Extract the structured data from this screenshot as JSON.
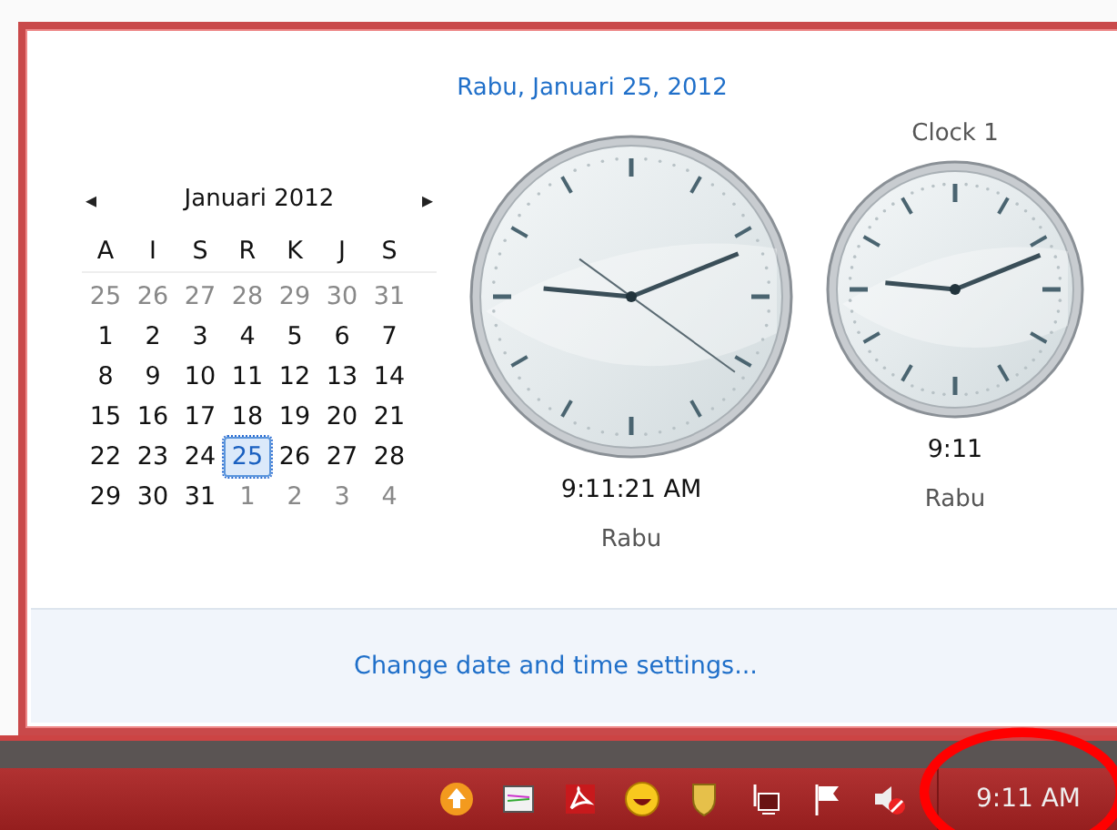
{
  "flyout": {
    "date_heading": "Rabu, Januari 25, 2012",
    "calendar": {
      "prev": "◂",
      "month": "Januari 2012",
      "next": "▸",
      "weekdays": [
        "A",
        "I",
        "S",
        "R",
        "K",
        "J",
        "S"
      ],
      "days": [
        {
          "label": "25",
          "other_month": true,
          "selected": false
        },
        {
          "label": "26",
          "other_month": true,
          "selected": false
        },
        {
          "label": "27",
          "other_month": true,
          "selected": false
        },
        {
          "label": "28",
          "other_month": true,
          "selected": false
        },
        {
          "label": "29",
          "other_month": true,
          "selected": false
        },
        {
          "label": "30",
          "other_month": true,
          "selected": false
        },
        {
          "label": "31",
          "other_month": true,
          "selected": false
        },
        {
          "label": "1",
          "other_month": false,
          "selected": false
        },
        {
          "label": "2",
          "other_month": false,
          "selected": false
        },
        {
          "label": "3",
          "other_month": false,
          "selected": false
        },
        {
          "label": "4",
          "other_month": false,
          "selected": false
        },
        {
          "label": "5",
          "other_month": false,
          "selected": false
        },
        {
          "label": "6",
          "other_month": false,
          "selected": false
        },
        {
          "label": "7",
          "other_month": false,
          "selected": false
        },
        {
          "label": "8",
          "other_month": false,
          "selected": false
        },
        {
          "label": "9",
          "other_month": false,
          "selected": false
        },
        {
          "label": "10",
          "other_month": false,
          "selected": false
        },
        {
          "label": "11",
          "other_month": false,
          "selected": false
        },
        {
          "label": "12",
          "other_month": false,
          "selected": false
        },
        {
          "label": "13",
          "other_month": false,
          "selected": false
        },
        {
          "label": "14",
          "other_month": false,
          "selected": false
        },
        {
          "label": "15",
          "other_month": false,
          "selected": false
        },
        {
          "label": "16",
          "other_month": false,
          "selected": false
        },
        {
          "label": "17",
          "other_month": false,
          "selected": false
        },
        {
          "label": "18",
          "other_month": false,
          "selected": false
        },
        {
          "label": "19",
          "other_month": false,
          "selected": false
        },
        {
          "label": "20",
          "other_month": false,
          "selected": false
        },
        {
          "label": "21",
          "other_month": false,
          "selected": false
        },
        {
          "label": "22",
          "other_month": false,
          "selected": false
        },
        {
          "label": "23",
          "other_month": false,
          "selected": false
        },
        {
          "label": "24",
          "other_month": false,
          "selected": false
        },
        {
          "label": "25",
          "other_month": false,
          "selected": true
        },
        {
          "label": "26",
          "other_month": false,
          "selected": false
        },
        {
          "label": "27",
          "other_month": false,
          "selected": false
        },
        {
          "label": "28",
          "other_month": false,
          "selected": false
        },
        {
          "label": "29",
          "other_month": false,
          "selected": false
        },
        {
          "label": "30",
          "other_month": false,
          "selected": false
        },
        {
          "label": "31",
          "other_month": false,
          "selected": false
        },
        {
          "label": "1",
          "other_month": true,
          "selected": false
        },
        {
          "label": "2",
          "other_month": true,
          "selected": false
        },
        {
          "label": "3",
          "other_month": true,
          "selected": false
        },
        {
          "label": "4",
          "other_month": true,
          "selected": false
        }
      ]
    },
    "clocks": [
      {
        "kind": "main",
        "time": "9:11:21 AM",
        "day": "Rabu"
      },
      {
        "kind": "extra",
        "title": "Clock 1",
        "time": "9:11",
        "day": "Rabu"
      }
    ],
    "settings_link": "Change date and time settings..."
  },
  "taskbar": {
    "clock": "9:11 AM"
  }
}
